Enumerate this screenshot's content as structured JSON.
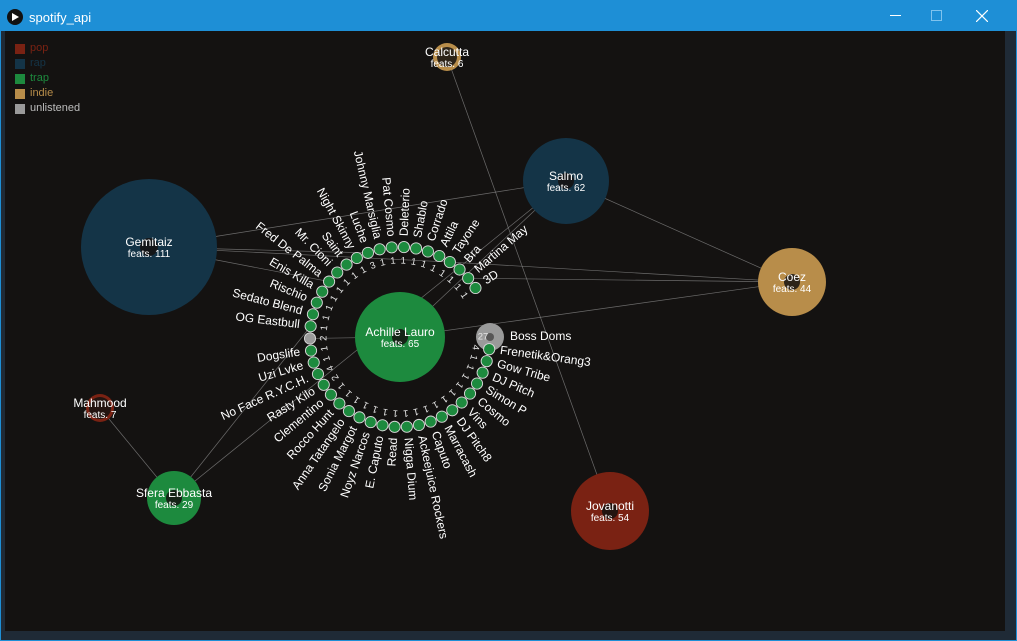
{
  "window": {
    "title": "spotify_api",
    "controls": [
      "minimize-icon",
      "maximize-icon",
      "close-icon"
    ]
  },
  "colors": {
    "titlebar": "#1e8fd6",
    "canvas": "#141211",
    "pop": "#7a2213",
    "rap": "#143447",
    "trap": "#1d8a3e",
    "indie": "#b88d4a",
    "unlistened": "#9a9a9a"
  },
  "legend": [
    {
      "label": "pop",
      "color": "#7a2213"
    },
    {
      "label": "rap",
      "color": "#143447"
    },
    {
      "label": "trap",
      "color": "#1d8a3e"
    },
    {
      "label": "indie",
      "color": "#b88d4a"
    },
    {
      "label": "unlistened",
      "color": "#9a9a9a",
      "text_color": "#bdbdbd"
    }
  ],
  "center": {
    "name": "Achille Lauro",
    "feats": "feats. 65",
    "genre": "trap"
  },
  "artists": [
    {
      "name": "Gemitaiz",
      "feats": "feats. 111",
      "genre": "rap"
    },
    {
      "name": "Salmo",
      "feats": "feats. 62",
      "genre": "rap"
    },
    {
      "name": "Calcutta",
      "feats": "feats. 6",
      "genre": "indie"
    },
    {
      "name": "Coez",
      "feats": "feats. 44",
      "genre": "indie"
    },
    {
      "name": "Jovanotti",
      "feats": "feats. 54",
      "genre": "pop"
    },
    {
      "name": "Mahmood",
      "feats": "feats. 7",
      "genre": "pop"
    },
    {
      "name": "Sfera Ebbasta",
      "feats": "feats. 29",
      "genre": "trap"
    }
  ],
  "ring": [
    {
      "name": "Boss Doms",
      "count": "27",
      "genre": "unlistened"
    },
    {
      "name": "Frenetik&Orang3",
      "count": "4",
      "genre": "trap"
    },
    {
      "name": "Gow Tribe",
      "count": "1",
      "genre": "trap"
    },
    {
      "name": "DJ Pitch",
      "count": "1",
      "genre": "trap"
    },
    {
      "name": "Simon P",
      "count": "1",
      "genre": "trap"
    },
    {
      "name": "Cosmo",
      "count": "1",
      "genre": "trap"
    },
    {
      "name": "Vins",
      "count": "1",
      "genre": "trap"
    },
    {
      "name": "DJ Pitch8",
      "count": "1",
      "genre": "trap"
    },
    {
      "name": "Marracash",
      "count": "1",
      "genre": "trap"
    },
    {
      "name": "Caputo",
      "count": "1",
      "genre": "trap"
    },
    {
      "name": "Ackeejuice Rockers",
      "count": "1",
      "genre": "trap"
    },
    {
      "name": "Nigga Dium",
      "count": "1",
      "genre": "trap"
    },
    {
      "name": "Read",
      "count": "1",
      "genre": "trap"
    },
    {
      "name": "E. Caputo",
      "count": "1",
      "genre": "trap"
    },
    {
      "name": "Noyz Narcos",
      "count": "1",
      "genre": "trap"
    },
    {
      "name": "Sonia Margot",
      "count": "1",
      "genre": "trap"
    },
    {
      "name": "Anna Tatangelo",
      "count": "1",
      "genre": "trap"
    },
    {
      "name": "Rocco Hunt",
      "count": "1",
      "genre": "trap"
    },
    {
      "name": "Clementino",
      "count": "1",
      "genre": "trap"
    },
    {
      "name": "Rasty Kilo",
      "count": "2",
      "genre": "trap"
    },
    {
      "name": "No Face R.Y.C.H.",
      "count": "4",
      "genre": "trap"
    },
    {
      "name": "Uzi Lvke",
      "count": "1",
      "genre": "trap"
    },
    {
      "name": "Dogslife",
      "count": "1",
      "genre": "trap"
    },
    {
      "name": "",
      "count": "2",
      "genre": "unlistened"
    },
    {
      "name": "OG Eastbull",
      "count": "1",
      "genre": "trap"
    },
    {
      "name": "Sedato Blend",
      "count": "1",
      "genre": "trap"
    },
    {
      "name": "Rischio",
      "count": "1",
      "genre": "trap"
    },
    {
      "name": "Enis Killa",
      "count": "1",
      "genre": "trap"
    },
    {
      "name": "Fred De Palma",
      "count": "1",
      "genre": "trap"
    },
    {
      "name": "Mr. Cioni",
      "count": "1",
      "genre": "trap"
    },
    {
      "name": "Saint",
      "count": "1",
      "genre": "trap"
    },
    {
      "name": "Night Skinny",
      "count": "1",
      "genre": "trap"
    },
    {
      "name": "Luche",
      "count": "3",
      "genre": "trap"
    },
    {
      "name": "Johnny Marsiglia",
      "count": "1",
      "genre": "trap"
    },
    {
      "name": "Pat Cosmo",
      "count": "1",
      "genre": "trap"
    },
    {
      "name": "Deleterio",
      "count": "1",
      "genre": "trap"
    },
    {
      "name": "Shablo",
      "count": "1",
      "genre": "trap"
    },
    {
      "name": "Corrado",
      "count": "1",
      "genre": "trap"
    },
    {
      "name": "Attila",
      "count": "1",
      "genre": "trap"
    },
    {
      "name": "Tayone",
      "count": "1",
      "genre": "trap"
    },
    {
      "name": "Bra",
      "count": "1",
      "genre": "trap"
    },
    {
      "name": "Martina May",
      "count": "1",
      "genre": "trap"
    },
    {
      "name": "3D",
      "count": "1",
      "genre": "trap"
    }
  ]
}
